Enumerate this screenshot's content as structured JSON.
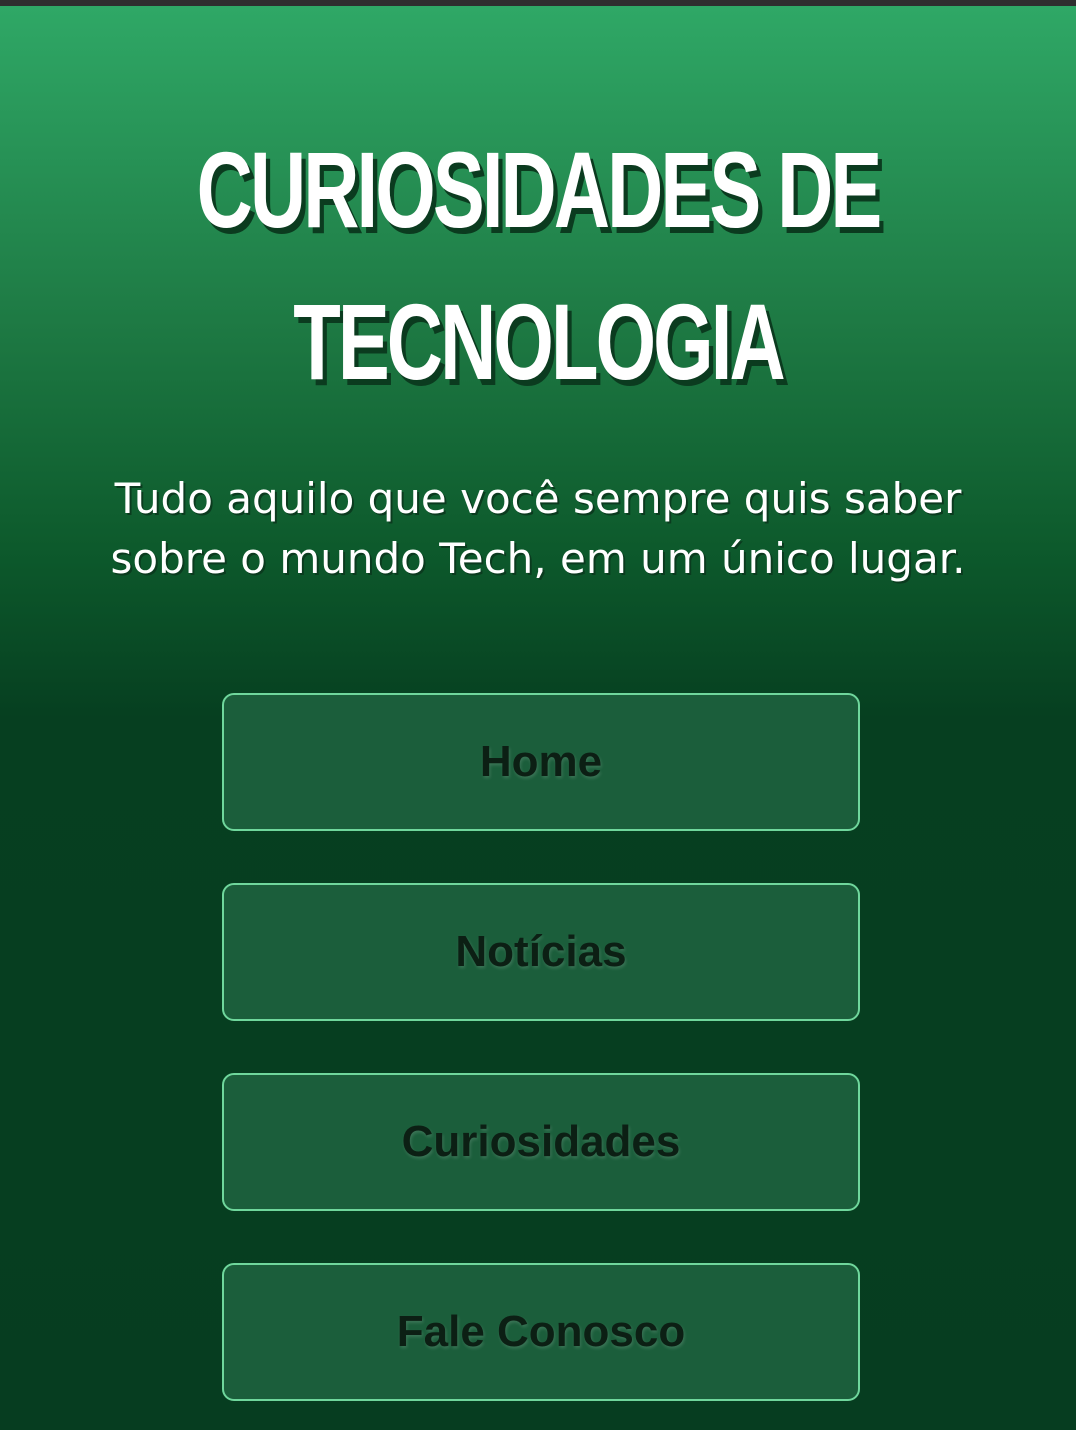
{
  "header": {
    "title_line1": "CURIOSIDADES DE",
    "title_line2": "TECNOLOGIA",
    "subtitle_line1": "Tudo aquilo que você sempre quis saber",
    "subtitle_line2": "sobre o mundo Tech, em um único lugar."
  },
  "nav": {
    "items": [
      {
        "label": "Home"
      },
      {
        "label": "Notícias"
      },
      {
        "label": "Curiosidades"
      },
      {
        "label": "Fale Conosco"
      }
    ]
  },
  "colors": {
    "gradient_top": "#2fa866",
    "gradient_bottom": "#063d20",
    "button_bg": "#1b5e3b",
    "button_border": "#6fd79c",
    "button_text": "#0c1f14",
    "title_text": "#ffffff"
  }
}
